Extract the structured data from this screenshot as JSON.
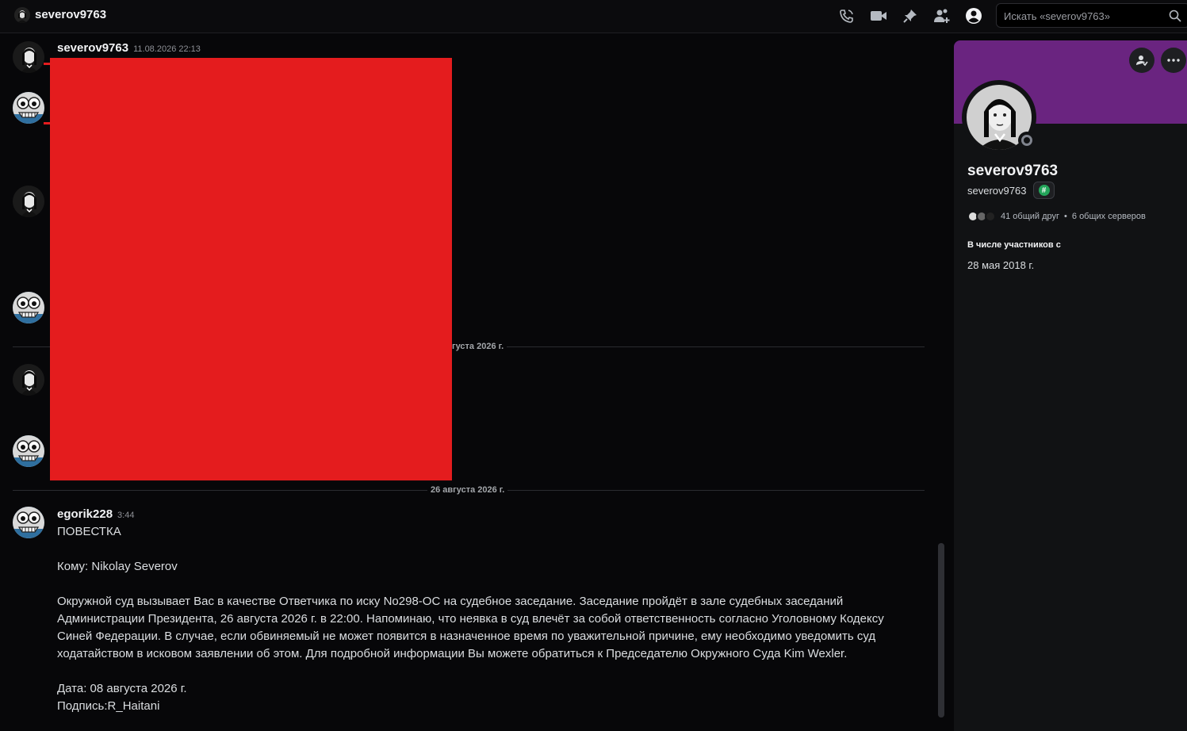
{
  "header": {
    "title": "severov9763",
    "search_placeholder": "Искать «severov9763»"
  },
  "messages": [
    {
      "username": "severov9763",
      "timestamp": "11.08.2026 22:13"
    }
  ],
  "dividers": {
    "partial": "густа 2026 г.",
    "full": "26 августа 2026 г."
  },
  "last_message": {
    "username": "egorik228",
    "timestamp": "3:44",
    "lines": [
      "ПОВЕСТКА",
      "",
      "Кому: Nikolay Severov",
      "",
      "Окружной суд вызывает Вас в качестве Ответчика по иску No298-OC на судебное заседание. Заседание пройдёт в зале судебных заседаний Администрации Президента, 26 августа 2026 г. в 22:00. Напоминаю, что неявка в суд влечёт за собой ответственность согласно Уголовному Кодексу Синей Федерации. В случае, если обвиняемый не может появится в назначенное время по уважительной причине, ему необходимо уведомить суд ходатайством в исковом заявлении об этом. Для подробной информации Вы можете обратиться к Председателю Окружного Суда Kim Wexler.",
      "",
      "Дата: 08 августа 2026 г.",
      "Подпись:R_Haitani"
    ]
  },
  "profile": {
    "display_name": "severov9763",
    "handle": "severov9763",
    "mutual_friends": "41 общий друг",
    "separator": "•",
    "mutual_servers": "6 общих серверов",
    "member_since_title": "В числе участников с",
    "member_since_date": "28 мая 2018 г.",
    "banner_color": "#6a2480"
  },
  "colors": {
    "redaction": "#e41c1e",
    "status_offline": "#80848e"
  }
}
